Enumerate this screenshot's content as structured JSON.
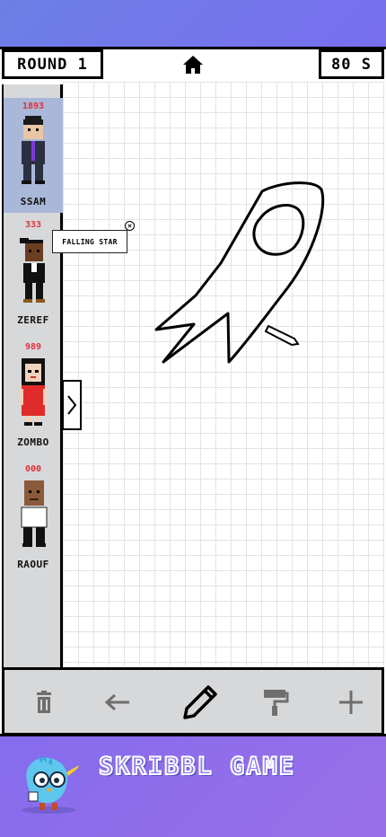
{
  "header": {
    "round_label": "ROUND 1",
    "timer_label": "80 S",
    "home_icon": "home-icon"
  },
  "players": [
    {
      "name": "SSAM",
      "score": "1893",
      "active": true
    },
    {
      "name": "ZEREF",
      "score": "333",
      "active": false
    },
    {
      "name": "ZOMBO",
      "score": "989",
      "active": false
    },
    {
      "name": "RAOUF",
      "score": "000",
      "active": false
    }
  ],
  "tooltip": {
    "word": "FALLING STAR"
  },
  "toolbar": {
    "tools": [
      "trash-icon",
      "arrow-left-icon",
      "pencil-icon",
      "paint-roller-icon",
      "plus-icon"
    ],
    "active_tool": "pencil-icon"
  },
  "footer": {
    "title": "SKRIBBL GAME"
  },
  "colors": {
    "background_start": "#6c7fe6",
    "background_end": "#9a6ee8",
    "sidebar": "#d7d8da",
    "active_player": "#a9b7d8",
    "score": "#e0303a"
  }
}
